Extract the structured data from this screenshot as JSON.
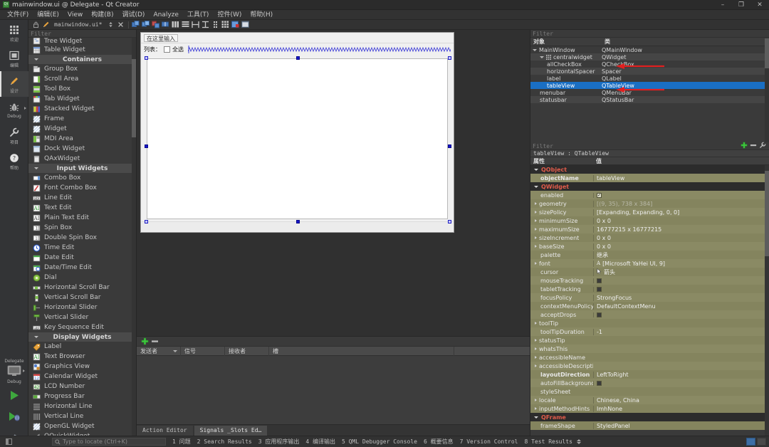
{
  "window": {
    "title": "mainwindow.ui @ Delegate - Qt Creator",
    "icon": "qt-creator-icon",
    "minimize": "–",
    "maximize": "❐",
    "close": "✕"
  },
  "menubar": {
    "items": [
      {
        "label": "文件(F)",
        "name": "menu-file"
      },
      {
        "label": "编辑(E)",
        "name": "menu-edit"
      },
      {
        "label": "View",
        "name": "menu-view"
      },
      {
        "label": "构建(B)",
        "name": "menu-build"
      },
      {
        "label": "调试(D)",
        "name": "menu-debug"
      },
      {
        "label": "Analyze",
        "name": "menu-analyze"
      },
      {
        "label": "工具(T)",
        "name": "menu-tools"
      },
      {
        "label": "控件(W)",
        "name": "menu-widgets"
      },
      {
        "label": "帮助(H)",
        "name": "menu-help"
      }
    ]
  },
  "toolbar": {
    "file_label": "mainwindow.ui*",
    "lock_icon": "lock-icon",
    "edit_icon": "pencil-icon",
    "split_icon": "split-icon",
    "close_icon": "✕",
    "design_tools": [
      "adjust-size-icon",
      "lay-out-horizontally-icon",
      "lay-out-vertically-icon",
      "lay-out-in-splitter-icon",
      "lay-out-in-form-layout-icon",
      "lay-out-in-grid-icon",
      "break-layout-icon",
      "grid-layout-icon",
      "buddy-edit-icon",
      "preview-icon"
    ]
  },
  "modebar": {
    "items": [
      {
        "label": "欢迎",
        "name": "mode-welcome",
        "icon": "grid-dots-icon",
        "active": false
      },
      {
        "label": "编辑",
        "name": "mode-edit",
        "icon": "document-icon",
        "active": false
      },
      {
        "label": "设计",
        "name": "mode-design",
        "icon": "pencil-icon",
        "active": true
      },
      {
        "label": "Debug",
        "name": "mode-debug",
        "icon": "bug-icon",
        "active": false
      },
      {
        "label": "项目",
        "name": "mode-projects",
        "icon": "wrench-icon",
        "active": false
      },
      {
        "label": "帮助",
        "name": "mode-help",
        "icon": "question-icon",
        "active": false
      }
    ],
    "kit_name": "Delegate",
    "build_config": "Debug",
    "run_button": "run-icon",
    "debug_button": "debug-run-icon",
    "build_button": "hammer-icon"
  },
  "widgetbox": {
    "filter_placeholder": "Filter",
    "rows": [
      {
        "label": "Tree Widget",
        "icon": "tree-widget-icon",
        "type": "item",
        "partial": true
      },
      {
        "label": "Table Widget",
        "icon": "table-widget-icon",
        "type": "item"
      },
      {
        "label": "Containers",
        "type": "category"
      },
      {
        "label": "Group Box",
        "icon": "group-box-icon",
        "type": "item"
      },
      {
        "label": "Scroll Area",
        "icon": "scroll-area-icon",
        "type": "item"
      },
      {
        "label": "Tool Box",
        "icon": "tool-box-icon",
        "type": "item"
      },
      {
        "label": "Tab Widget",
        "icon": "tab-widget-icon",
        "type": "item"
      },
      {
        "label": "Stacked Widget",
        "icon": "stacked-widget-icon",
        "type": "item"
      },
      {
        "label": "Frame",
        "icon": "frame-icon",
        "type": "item"
      },
      {
        "label": "Widget",
        "icon": "widget-icon",
        "type": "item"
      },
      {
        "label": "MDI Area",
        "icon": "mdi-area-icon",
        "type": "item"
      },
      {
        "label": "Dock Widget",
        "icon": "dock-widget-icon",
        "type": "item"
      },
      {
        "label": "QAxWidget",
        "icon": "qax-widget-icon",
        "type": "item"
      },
      {
        "label": "Input Widgets",
        "type": "category"
      },
      {
        "label": "Combo Box",
        "icon": "combo-box-icon",
        "type": "item"
      },
      {
        "label": "Font Combo Box",
        "icon": "font-combo-box-icon",
        "type": "item"
      },
      {
        "label": "Line Edit",
        "icon": "line-edit-icon",
        "type": "item"
      },
      {
        "label": "Text Edit",
        "icon": "text-edit-icon",
        "type": "item"
      },
      {
        "label": "Plain Text Edit",
        "icon": "plain-text-edit-icon",
        "type": "item"
      },
      {
        "label": "Spin Box",
        "icon": "spin-box-icon",
        "type": "item"
      },
      {
        "label": "Double Spin Box",
        "icon": "double-spin-box-icon",
        "type": "item"
      },
      {
        "label": "Time Edit",
        "icon": "time-edit-icon",
        "type": "item"
      },
      {
        "label": "Date Edit",
        "icon": "date-edit-icon",
        "type": "item"
      },
      {
        "label": "Date/Time Edit",
        "icon": "date-time-edit-icon",
        "type": "item"
      },
      {
        "label": "Dial",
        "icon": "dial-icon",
        "type": "item"
      },
      {
        "label": "Horizontal Scroll Bar",
        "icon": "horizontal-scroll-bar-icon",
        "type": "item"
      },
      {
        "label": "Vertical Scroll Bar",
        "icon": "vertical-scroll-bar-icon",
        "type": "item"
      },
      {
        "label": "Horizontal Slider",
        "icon": "horizontal-slider-icon",
        "type": "item"
      },
      {
        "label": "Vertical Slider",
        "icon": "vertical-slider-icon",
        "type": "item"
      },
      {
        "label": "Key Sequence Edit",
        "icon": "key-sequence-edit-icon",
        "type": "item"
      },
      {
        "label": "Display Widgets",
        "type": "category"
      },
      {
        "label": "Label",
        "icon": "label-icon",
        "type": "item"
      },
      {
        "label": "Text Browser",
        "icon": "text-browser-icon",
        "type": "item"
      },
      {
        "label": "Graphics View",
        "icon": "graphics-view-icon",
        "type": "item"
      },
      {
        "label": "Calendar Widget",
        "icon": "calendar-widget-icon",
        "type": "item"
      },
      {
        "label": "LCD Number",
        "icon": "lcd-number-icon",
        "type": "item"
      },
      {
        "label": "Progress Bar",
        "icon": "progress-bar-icon",
        "type": "item"
      },
      {
        "label": "Horizontal Line",
        "icon": "horizontal-line-icon",
        "type": "item"
      },
      {
        "label": "Vertical Line",
        "icon": "vertical-line-icon",
        "type": "item"
      },
      {
        "label": "OpenGL Widget",
        "icon": "opengl-widget-icon",
        "type": "item"
      },
      {
        "label": "QQuickWidget",
        "icon": "qquick-widget-icon",
        "type": "item"
      }
    ]
  },
  "form": {
    "type_here": "在这里输入",
    "list_label": "列表：",
    "select_all_label": "全选",
    "select_all_checked": false,
    "spacer_name": "horizontal-spacer",
    "table_name": "tableView"
  },
  "signals_slots": {
    "add_label": "+",
    "remove_label": "−",
    "columns": [
      "发送者",
      "信号",
      "接收者",
      "槽"
    ],
    "rows": []
  },
  "bottom_tabs": {
    "tabs": [
      {
        "label": "Action Editor",
        "active": false
      },
      {
        "label": "Signals _Slots Ed…",
        "active": true
      }
    ]
  },
  "object_tree": {
    "filter_placeholder": "Filter",
    "columns": [
      "对象",
      "类"
    ],
    "rows": [
      {
        "name": "MainWindow",
        "class": "QMainWindow",
        "depth": 0,
        "expander": true,
        "selected": false
      },
      {
        "name": "centralwidget",
        "class": "QWidget",
        "depth": 1,
        "expander": true,
        "selected": false,
        "icon": "layout-grid-icon"
      },
      {
        "name": "allCheckBox",
        "class": "QCheckBox",
        "depth": 2,
        "selected": false,
        "annotated": true
      },
      {
        "name": "horizontalSpacer",
        "class": "Spacer",
        "depth": 2,
        "selected": false
      },
      {
        "name": "label",
        "class": "QLabel",
        "depth": 2,
        "selected": false
      },
      {
        "name": "tableView",
        "class": "QTableView",
        "depth": 2,
        "selected": true,
        "annotated": true
      },
      {
        "name": "menubar",
        "class": "QMenuBar",
        "depth": 1,
        "selected": false
      },
      {
        "name": "statusbar",
        "class": "QStatusBar",
        "depth": 1,
        "selected": false
      }
    ]
  },
  "property_editor": {
    "filter_placeholder": "Filter",
    "add_icon": "plus-icon",
    "remove_icon": "minus-icon",
    "config_icon": "wrench-icon",
    "object_header": "tableView : QTableView",
    "columns": [
      "属性",
      "值"
    ],
    "rows": [
      {
        "key": "QObject",
        "type": "group",
        "expanded": true
      },
      {
        "key": "objectName",
        "value": "tableView",
        "type": "prop",
        "bold": true
      },
      {
        "key": "QWidget",
        "type": "group",
        "expanded": true
      },
      {
        "key": "enabled",
        "value": "",
        "type": "checkbox",
        "checked": true
      },
      {
        "key": "geometry",
        "value": "[(9, 35), 738 x 384]",
        "type": "prop",
        "expander": true,
        "dim": true
      },
      {
        "key": "sizePolicy",
        "value": "[Expanding, Expanding, 0, 0]",
        "type": "prop",
        "expander": true
      },
      {
        "key": "minimumSize",
        "value": "0 x 0",
        "type": "prop",
        "expander": true
      },
      {
        "key": "maximumSize",
        "value": "16777215 x 16777215",
        "type": "prop",
        "expander": true
      },
      {
        "key": "sizeIncrement",
        "value": "0 x 0",
        "type": "prop",
        "expander": true
      },
      {
        "key": "baseSize",
        "value": "0 x 0",
        "type": "prop",
        "expander": true
      },
      {
        "key": "palette",
        "value": "继承",
        "type": "prop"
      },
      {
        "key": "font",
        "value": "[Microsoft YaHei UI, 9]",
        "type": "prop",
        "expander": true,
        "icon": "font-icon"
      },
      {
        "key": "cursor",
        "value": "箭头",
        "type": "prop",
        "icon": "cursor-icon"
      },
      {
        "key": "mouseTracking",
        "value": "",
        "type": "checkbox",
        "checked": false
      },
      {
        "key": "tabletTracking",
        "value": "",
        "type": "checkbox",
        "checked": false
      },
      {
        "key": "focusPolicy",
        "value": "StrongFocus",
        "type": "prop"
      },
      {
        "key": "contextMenuPolicy",
        "value": "DefaultContextMenu",
        "type": "prop"
      },
      {
        "key": "acceptDrops",
        "value": "",
        "type": "checkbox",
        "checked": false
      },
      {
        "key": "toolTip",
        "value": "",
        "type": "prop",
        "expander": true
      },
      {
        "key": "toolTipDuration",
        "value": "-1",
        "type": "prop"
      },
      {
        "key": "statusTip",
        "value": "",
        "type": "prop",
        "expander": true
      },
      {
        "key": "whatsThis",
        "value": "",
        "type": "prop",
        "expander": true
      },
      {
        "key": "accessibleName",
        "value": "",
        "type": "prop",
        "expander": true
      },
      {
        "key": "accessibleDescripti…",
        "value": "",
        "type": "prop",
        "expander": true
      },
      {
        "key": "layoutDirection",
        "value": "LeftToRight",
        "type": "prop",
        "bold": true
      },
      {
        "key": "autoFillBackground",
        "value": "",
        "type": "checkbox",
        "checked": false
      },
      {
        "key": "styleSheet",
        "value": "",
        "type": "prop"
      },
      {
        "key": "locale",
        "value": "Chinese, China",
        "type": "prop",
        "expander": true
      },
      {
        "key": "inputMethodHints",
        "value": "ImhNone",
        "type": "prop",
        "expander": true
      },
      {
        "key": "QFrame",
        "type": "group",
        "expanded": true
      },
      {
        "key": "frameShape",
        "value": "StyledPanel",
        "type": "prop"
      }
    ]
  },
  "statusbar": {
    "locator_placeholder": "Type to locate (Ctrl+K)",
    "search_icon": "search-icon",
    "items": [
      "1 问题",
      "2 Search Results",
      "3 应用程序输出",
      "4 编译输出",
      "5 QML Debugger Console",
      "6 概要信息",
      "7 Version Control",
      "8 Test Results"
    ]
  },
  "colors": {
    "chrome": "#323232",
    "panel": "#3a3a3a",
    "selection_blue": "#1a6fc4",
    "property_olive": "#84845e",
    "group_red": "#e05b4a",
    "annotation_red": "#e02020",
    "accent_green": "#3ea83e"
  }
}
